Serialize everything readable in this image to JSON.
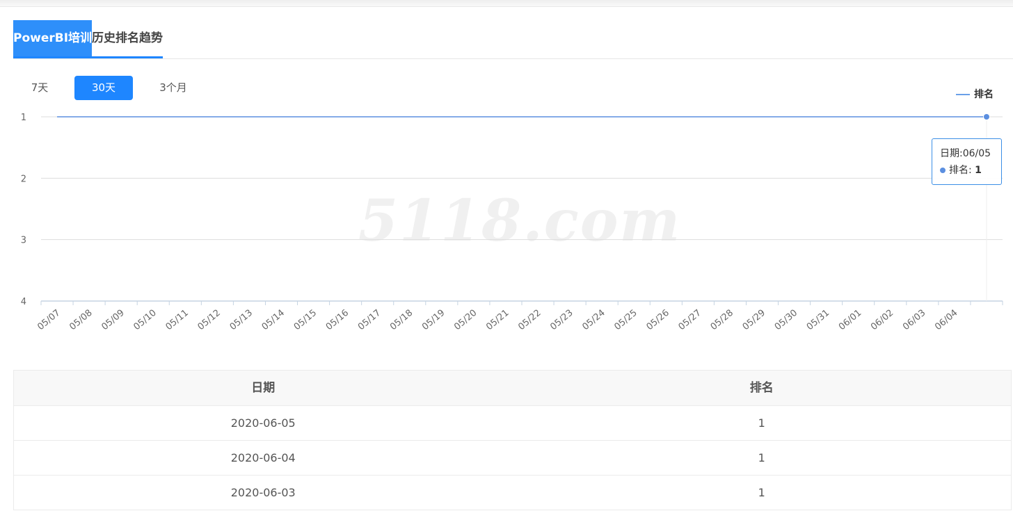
{
  "header": {
    "title_keyword": "PowerBI培训",
    "title_suffix": "历史排名趋势"
  },
  "range_tabs": [
    {
      "label": "7天",
      "active": false
    },
    {
      "label": "30天",
      "active": true
    },
    {
      "label": "3个月",
      "active": false
    }
  ],
  "watermark": "5118.com",
  "tooltip": {
    "date_label": "日期:06/05",
    "series_label": "排名:",
    "value": "1"
  },
  "chart_data": {
    "type": "line",
    "legend": [
      "排名"
    ],
    "legend_position": "top-right",
    "y_axis": {
      "ticks": [
        "1",
        "2",
        "3",
        "4"
      ],
      "inverted": true,
      "range": [
        1,
        4
      ]
    },
    "x": [
      "05/07",
      "05/08",
      "05/09",
      "05/10",
      "05/11",
      "05/12",
      "05/13",
      "05/14",
      "05/15",
      "05/16",
      "05/17",
      "05/18",
      "05/19",
      "05/20",
      "05/21",
      "05/22",
      "05/23",
      "05/24",
      "05/25",
      "05/26",
      "05/27",
      "05/28",
      "05/29",
      "05/30",
      "05/31",
      "06/01",
      "06/02",
      "06/03",
      "06/04",
      "06/05"
    ],
    "x_tick_labels": [
      "05/07",
      "05/08",
      "05/09",
      "05/10",
      "05/11",
      "05/12",
      "05/13",
      "05/14",
      "05/15",
      "05/16",
      "05/17",
      "05/18",
      "05/19",
      "05/20",
      "05/21",
      "05/22",
      "05/23",
      "05/24",
      "05/25",
      "05/26",
      "05/27",
      "05/28",
      "05/29",
      "05/30",
      "05/31",
      "06/01",
      "06/02",
      "06/03",
      "06/04"
    ],
    "series": [
      {
        "name": "排名",
        "values": [
          1,
          1,
          1,
          1,
          1,
          1,
          1,
          1,
          1,
          1,
          1,
          1,
          1,
          1,
          1,
          1,
          1,
          1,
          1,
          1,
          1,
          1,
          1,
          1,
          1,
          1,
          1,
          1,
          1,
          1
        ]
      }
    ],
    "grid": true,
    "colors": {
      "line": "#5b8fe0",
      "grid": "#dddddd",
      "axis": "#c5d3e2",
      "label": "#666666"
    }
  },
  "table": {
    "headers": [
      "日期",
      "排名"
    ],
    "rows": [
      [
        "2020-06-05",
        "1"
      ],
      [
        "2020-06-04",
        "1"
      ],
      [
        "2020-06-03",
        "1"
      ]
    ]
  }
}
